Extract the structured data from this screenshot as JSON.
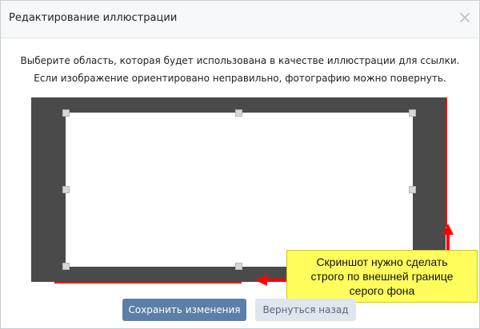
{
  "dialog": {
    "title": "Редактирование иллюстрации",
    "close_icon": "close-icon"
  },
  "instructions": {
    "line1": "Выберите область, которая будет использована в качестве иллюстрации для ссылки.",
    "line2": "Если изображение ориентировано неправильно, фотографию можно повернуть."
  },
  "annotation": {
    "line1": "Скриншот нужно сделать",
    "line2": "строго по внешней границе",
    "line3": "серого фона"
  },
  "buttons": {
    "save": "Сохранить изменения",
    "back": "Вернуться назад"
  },
  "colors": {
    "crop_background": "#4a4a4a",
    "primary_button": "#5b7fa6",
    "annotation_fill": "#fffe5c",
    "marker_red": "#ff0000"
  }
}
